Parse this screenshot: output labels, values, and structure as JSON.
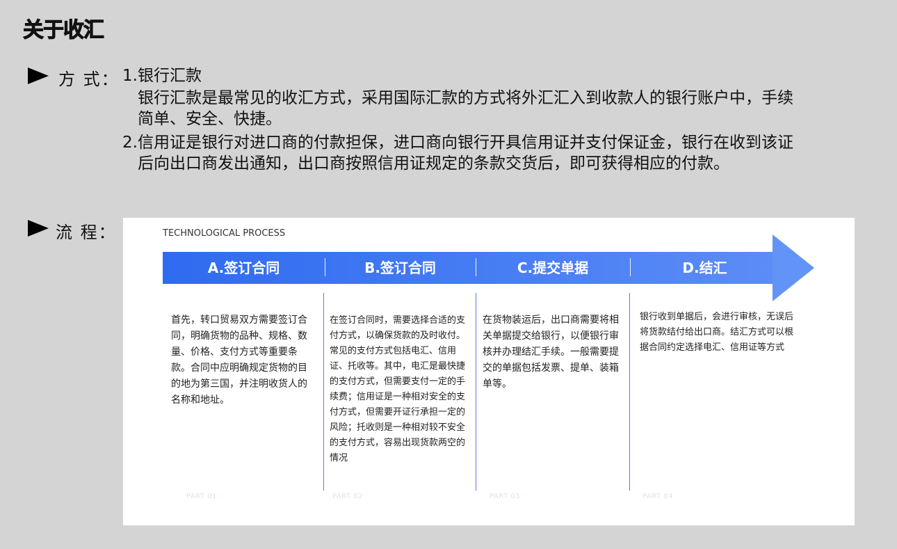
{
  "page": {
    "title": "关于收汇"
  },
  "method": {
    "label": "方  式：",
    "item1_title": "1.银行汇款",
    "item1_line1": "银行汇款是最常见的收汇方式，采用国际汇款的方式将外汇汇入到收款人的银行账户中，手续",
    "item1_line2": "简单、安全、快捷。",
    "item2_line1": "2.信用证是银行对进口商的付款担保，进口商向银行开具信用证并支付保证金，银行在收到该证",
    "item2_line2": "后向出口商发出通知，出口商按照信用证规定的条款交货后，即可获得相应的付款。"
  },
  "process": {
    "label": "流  程：",
    "caption": "TECHNOLOGICAL PROCESS",
    "steps": [
      {
        "title": "A.签订合同",
        "desc": "首先，转口贸易双方需要签订合同，明确货物的品种、规格、数量、价格、支付方式等重要条款。合同中应明确规定货物的目的地为第三国，并注明收货人的名称和地址。",
        "part": "PART 01"
      },
      {
        "title": "B.签订合同",
        "desc": "在签订合同时，需要选择合适的支付方式，以确保货款的及时收付。常见的支付方式包括电汇、信用证、托收等。其中，电汇是最快捷的支付方式，但需要支付一定的手续费；信用证是一种相对安全的支付方式，但需要开证行承担一定的风险；托收则是一种相对较不安全的支付方式，容易出现货款两空的情况",
        "part": "PART 02"
      },
      {
        "title": "C.提交单据",
        "desc": "在货物装运后，出口商需要将相关单据提交给银行，以便银行审核并办理结汇手续。一般需要提交的单据包括发票、提单、装箱单等。",
        "part": "PART 03"
      },
      {
        "title": "D.结汇",
        "desc": "银行收到单据后，会进行审核，无误后将货款结付给出口商。结汇方式可以根据合同约定选择电汇、信用证等方式",
        "part": "PART 04"
      }
    ]
  },
  "colors": {
    "band_start": "#2f6bf0",
    "band_end": "#6294f7",
    "background": "#d4d4d4"
  }
}
